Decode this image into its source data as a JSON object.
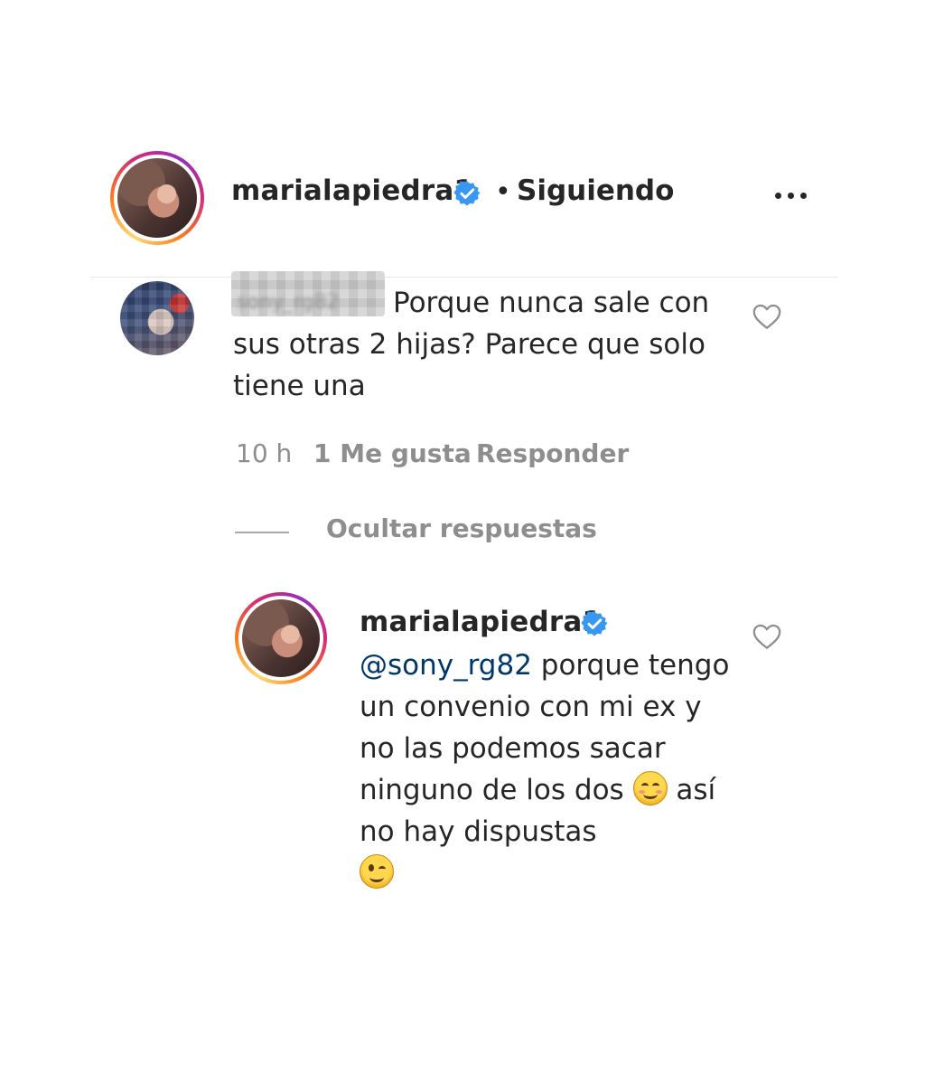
{
  "post": {
    "author": "marialapiedra1",
    "separator": "•",
    "follow_state": "Siguiendo",
    "more_icon": "more-horizontal-icon"
  },
  "comment": {
    "author_redacted": "sony_rg82",
    "text": "Porque nunca sale con sus otras 2 hijas? Parece que solo tiene una",
    "time": "10 h",
    "likes": "1 Me gusta",
    "reply_label": "Responder",
    "hide_replies_label": "Ocultar respuestas"
  },
  "reply": {
    "author": "marialapiedra1",
    "mention": "@sony_rg82",
    "text_part1": " porque tengo un convenio con mi ex y no las podemos sacar ninguno de los dos ",
    "text_part2": " así no hay dispustas ",
    "emoji_1": "smiling-face-emoji",
    "emoji_2": "winking-face-emoji"
  },
  "colors": {
    "text": "#262626",
    "muted": "#8e8e8e",
    "verified": "#3897f0",
    "mention": "#00376b",
    "divider": "#e6e6e6"
  }
}
